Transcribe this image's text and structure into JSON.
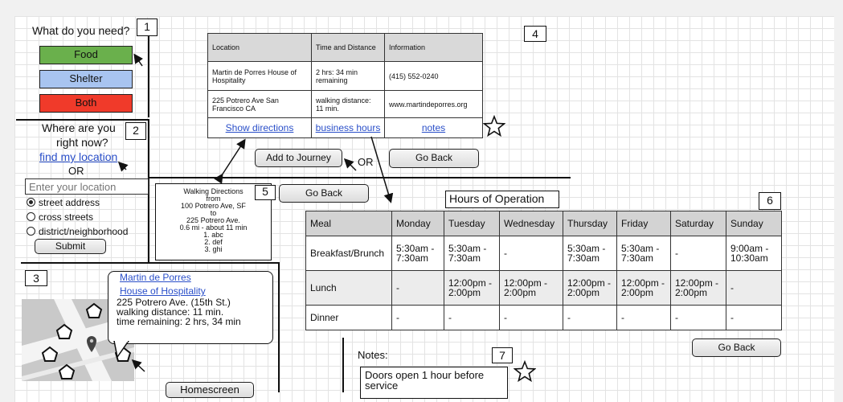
{
  "colors": {
    "food": "#6ab04c",
    "shelter": "#a8c4f0",
    "both": "#f03a2a",
    "link": "#2a4fc9",
    "table_header": "#d3d3d3"
  },
  "icons": [
    "star-icon",
    "arrow-icon",
    "map-pin-icon",
    "pentagon-icon"
  ],
  "panel1": {
    "number": "1",
    "question": "What do you need?",
    "buttons": [
      "Food",
      "Shelter",
      "Both"
    ]
  },
  "panel2": {
    "number": "2",
    "question_line1": "Where are you",
    "question_line2": "right now?",
    "find_location": "find my location",
    "or": "OR",
    "location_placeholder": "Enter your location",
    "options": [
      "street address",
      "cross streets",
      "district/neighborhood"
    ],
    "submit": "Submit"
  },
  "panel3": {
    "number": "3",
    "popup_link1": "Martin de Porres",
    "popup_link2": "House of Hospitality",
    "popup_lines": [
      "225 Potrero Ave. (15th St.)",
      "walking distance: 11 min.",
      "time remaining: 2 hrs, 34 min"
    ],
    "homescreen": "Homescreen"
  },
  "panel4": {
    "number": "4",
    "headers": [
      "Location",
      "Time and Distance",
      "Information"
    ],
    "row1": [
      "Martin de Porres House of Hospitality",
      "2 hrs: 34 min remaining",
      "(415) 552-0240"
    ],
    "row2": [
      "225 Potrero Ave San Francisco CA",
      "walking distance: 11 min.",
      "www.martindeporres.org"
    ],
    "links": [
      "Show directions",
      "business hours",
      "notes"
    ],
    "add_journey": "Add to Journey",
    "or": "OR",
    "go_back": "Go Back"
  },
  "panel5": {
    "number": "5",
    "lines": [
      "Walking Directions",
      "from",
      "100 Potrero Ave, SF",
      "to",
      "225 Potrero Ave.",
      "0.6 mi - about 11 min",
      "1. abc",
      "2. def",
      "3. ghi"
    ],
    "go_back": "Go Back"
  },
  "panel6": {
    "number": "6",
    "title": "Hours of Operation",
    "headers": [
      "Meal",
      "Monday",
      "Tuesday",
      "Wednesday",
      "Thursday",
      "Friday",
      "Saturday",
      "Sunday"
    ],
    "rows": [
      [
        "Breakfast/Brunch",
        "5:30am - 7:30am",
        "5:30am - 7:30am",
        "-",
        "5:30am - 7:30am",
        "5:30am - 7:30am",
        "-",
        "9:00am - 10:30am"
      ],
      [
        "Lunch",
        "-",
        "12:00pm - 2:00pm",
        "12:00pm - 2:00pm",
        "12:00pm - 2:00pm",
        "12:00pm - 2:00pm",
        "12:00pm - 2:00pm",
        "-"
      ],
      [
        "Dinner",
        "-",
        "-",
        "-",
        "-",
        "-",
        "-",
        "-"
      ]
    ],
    "go_back": "Go Back"
  },
  "panel7": {
    "number": "7",
    "label": "Notes:",
    "note": "Doors open 1 hour before service"
  }
}
